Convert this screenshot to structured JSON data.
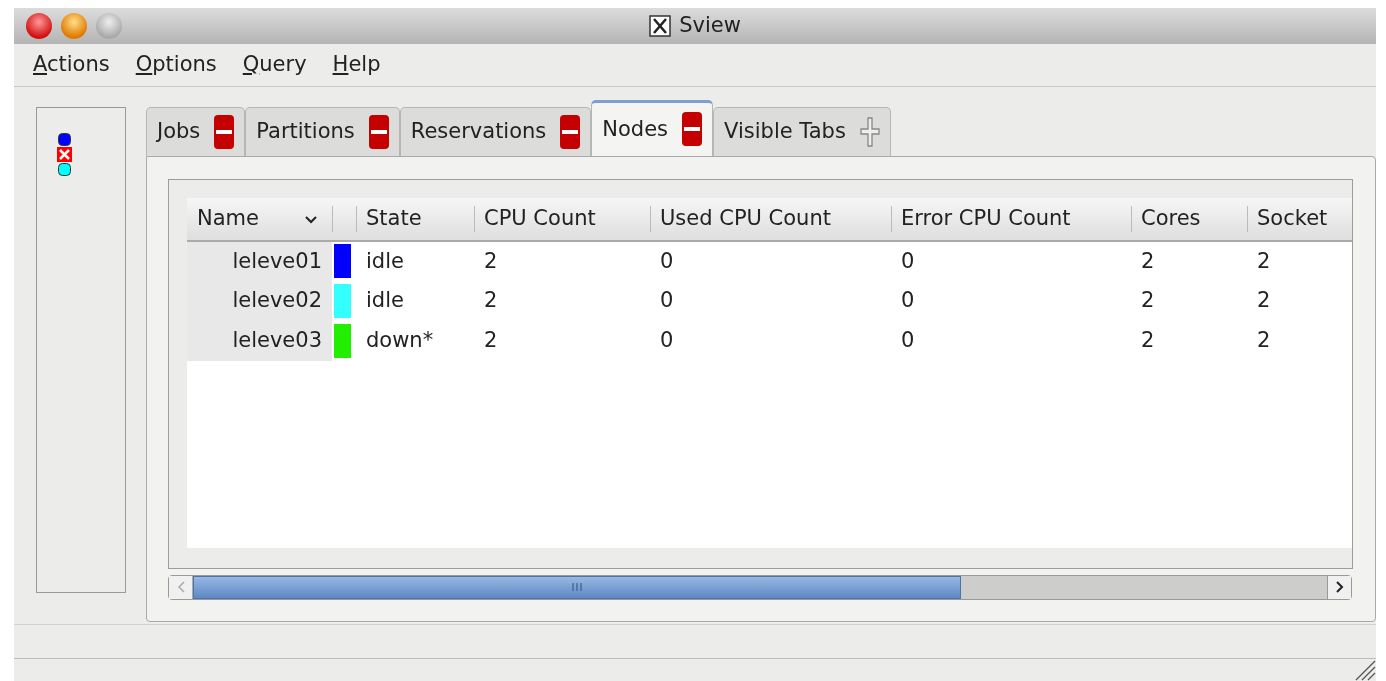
{
  "window": {
    "title": "Sview"
  },
  "menu": [
    "Actions",
    "Options",
    "Query",
    "Help"
  ],
  "legend": [
    {
      "kind": "square",
      "color": "#0000ff"
    },
    {
      "kind": "cross",
      "color": "#ff0000"
    },
    {
      "kind": "square",
      "color": "#00ffff"
    }
  ],
  "tabs": [
    {
      "label": "Jobs",
      "selected": false,
      "kind": "close"
    },
    {
      "label": "Partitions",
      "selected": false,
      "kind": "close"
    },
    {
      "label": "Reservations",
      "selected": false,
      "kind": "close"
    },
    {
      "label": "Nodes",
      "selected": true,
      "kind": "close"
    },
    {
      "label": "Visible Tabs",
      "selected": false,
      "kind": "add"
    }
  ],
  "table": {
    "columns": [
      {
        "label": "Name",
        "sorted": true
      },
      {
        "sorted": false
      },
      {
        "label": "State",
        "sorted": false
      },
      {
        "label": "CPU Count",
        "sorted": false
      },
      {
        "label": "Used CPU Count",
        "sorted": false
      },
      {
        "label": "Error CPU Count",
        "sorted": false
      },
      {
        "label": "Cores",
        "sorted": false
      },
      {
        "label": "Socket",
        "sorted": false
      }
    ],
    "rows": [
      {
        "color": "#0000ff",
        "cells": [
          "leleve01",
          "",
          "idle",
          "2",
          "0",
          "0",
          "2",
          "2"
        ]
      },
      {
        "color": "#33ffff",
        "cells": [
          "leleve02",
          "",
          "idle",
          "2",
          "0",
          "0",
          "2",
          "2"
        ]
      },
      {
        "color": "#22ee00",
        "cells": [
          "leleve03",
          "",
          "down*",
          "2",
          "0",
          "0",
          "2",
          "2"
        ]
      }
    ]
  }
}
